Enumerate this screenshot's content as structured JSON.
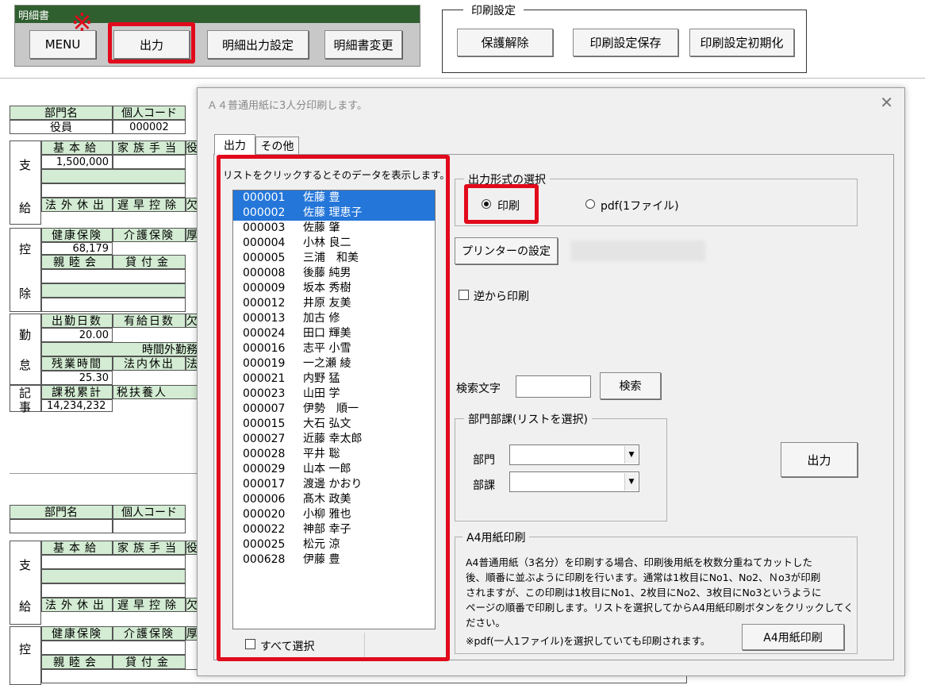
{
  "toolbar": {
    "title": "明細書",
    "buttons": [
      "MENU",
      "出力",
      "明細出力設定",
      "明細書変更"
    ],
    "x_mark": "※"
  },
  "print_settings": {
    "title": "印刷設定",
    "buttons": [
      "保護解除",
      "印刷設定保存",
      "印刷設定初期化"
    ]
  },
  "sheet": {
    "header1": [
      "部門名",
      "個人コード"
    ],
    "row1": [
      "役員",
      "000002"
    ],
    "pay_side": [
      "支",
      "給"
    ],
    "deduct_side": [
      "控",
      "除"
    ],
    "attend_side": [
      "勤",
      "怠"
    ],
    "note_side": [
      "記",
      "事"
    ],
    "pay_labels": [
      "基本給",
      "家族手当",
      "役"
    ],
    "pay_value": "1,500,000",
    "pay_labels2": [
      "法外休出",
      "遅早控除",
      "欠"
    ],
    "deduct_labels": [
      "健康保険",
      "介護保険",
      "厚"
    ],
    "deduct_value": "68,179",
    "deduct_labels2": [
      "親睦会",
      "貸付金"
    ],
    "attend_labels": [
      "出勤日数",
      "有給日数",
      "欠"
    ],
    "attend_value": "20.00",
    "overtime_label": "時間外勤務",
    "attend_labels2": [
      "残業時間",
      "法内休出",
      "法"
    ],
    "overtime_value": "25.30",
    "note_labels": [
      "課税累計",
      "税扶養人"
    ],
    "note_value": "14,234,232",
    "header2": [
      "部門名",
      "個人コード"
    ],
    "pay_labels_b": [
      "基本給",
      "家族手当",
      "役"
    ],
    "pay_labels2_b": [
      "法外休出",
      "遅早控除",
      "欠"
    ],
    "deduct_labels_b": [
      "健康保険",
      "介護保険",
      "厚"
    ],
    "deduct_labels2_b": [
      "親睦会",
      "貸付金"
    ]
  },
  "dialog": {
    "title": "Ａ４普通用紙に3人分印刷します。",
    "close": "✕",
    "tabs": [
      "出力",
      "その他"
    ],
    "list_caption": "リストをクリックするとそのデータを表示します。",
    "employees": [
      {
        "code": "000001",
        "name": "佐藤 豊",
        "selected": true
      },
      {
        "code": "000002",
        "name": "佐藤 理恵子",
        "selected": true
      },
      {
        "code": "000003",
        "name": "佐藤 肇",
        "selected": false
      },
      {
        "code": "000004",
        "name": "小林 良二",
        "selected": false
      },
      {
        "code": "000005",
        "name": "三浦　和美",
        "selected": false
      },
      {
        "code": "000008",
        "name": "後藤 純男",
        "selected": false
      },
      {
        "code": "000009",
        "name": "坂本 秀樹",
        "selected": false
      },
      {
        "code": "000012",
        "name": "井原 友美",
        "selected": false
      },
      {
        "code": "000013",
        "name": "加古 修",
        "selected": false
      },
      {
        "code": "000024",
        "name": "田口 輝美",
        "selected": false
      },
      {
        "code": "000016",
        "name": "志平 小雪",
        "selected": false
      },
      {
        "code": "000019",
        "name": "一之瀬 綾",
        "selected": false
      },
      {
        "code": "000021",
        "name": "内野 猛",
        "selected": false
      },
      {
        "code": "000023",
        "name": "山田 学",
        "selected": false
      },
      {
        "code": "000007",
        "name": "伊勢　順一",
        "selected": false
      },
      {
        "code": "000015",
        "name": "大石 弘文",
        "selected": false
      },
      {
        "code": "000027",
        "name": "近藤 幸太郎",
        "selected": false
      },
      {
        "code": "000028",
        "name": "平井 聡",
        "selected": false
      },
      {
        "code": "000029",
        "name": "山本 一郎",
        "selected": false
      },
      {
        "code": "000017",
        "name": "渡邊 かおり",
        "selected": false
      },
      {
        "code": "000006",
        "name": "髙木 政美",
        "selected": false
      },
      {
        "code": "000020",
        "name": "小柳 雅也",
        "selected": false
      },
      {
        "code": "000022",
        "name": "神部 幸子",
        "selected": false
      },
      {
        "code": "000025",
        "name": "松元 涼",
        "selected": false
      },
      {
        "code": "000628",
        "name": "伊藤 豊",
        "selected": false
      }
    ],
    "select_all_label": "すべて選択",
    "output_format": {
      "title": "出力形式の選択",
      "options": [
        "印刷",
        "pdf(1ファイル)"
      ],
      "selected": "印刷"
    },
    "printer_button": "プリンターの設定",
    "reverse_print_label": "逆から印刷",
    "search": {
      "label": "検索文字",
      "value": "",
      "button": "検索"
    },
    "dept_group": {
      "title": "部門部課(リストを選択)",
      "dept_label": "部門",
      "section_label": "部課",
      "dept_value": "",
      "section_value": ""
    },
    "output_button": "出力",
    "a4_group": {
      "title": "A4用紙印刷",
      "description": [
        "A4普通用紙（3名分）を印刷する場合、印刷後用紙を枚数分重ねてカットした",
        "後、順番に並ぶように印刷を行います。通常は1枚目にNo1、No2、Ｎo3が印刷",
        "されますが、この印刷は1枚目にNo1、2枚目にNo2、3枚目にNo3というように",
        "ページの順番で印刷します。リストを選択してからA4用紙印刷ボタンをクリックしてく",
        "ださい。",
        "※pdf(一人1ファイル)を選択していても印刷されます。"
      ],
      "button": "A4用紙印刷"
    }
  },
  "colors": {
    "highlight_red": "#e1091b",
    "selection_blue": "#2476d9",
    "cell_green": "#d3ecd3",
    "toolbar_green": "#2f5f2f"
  }
}
